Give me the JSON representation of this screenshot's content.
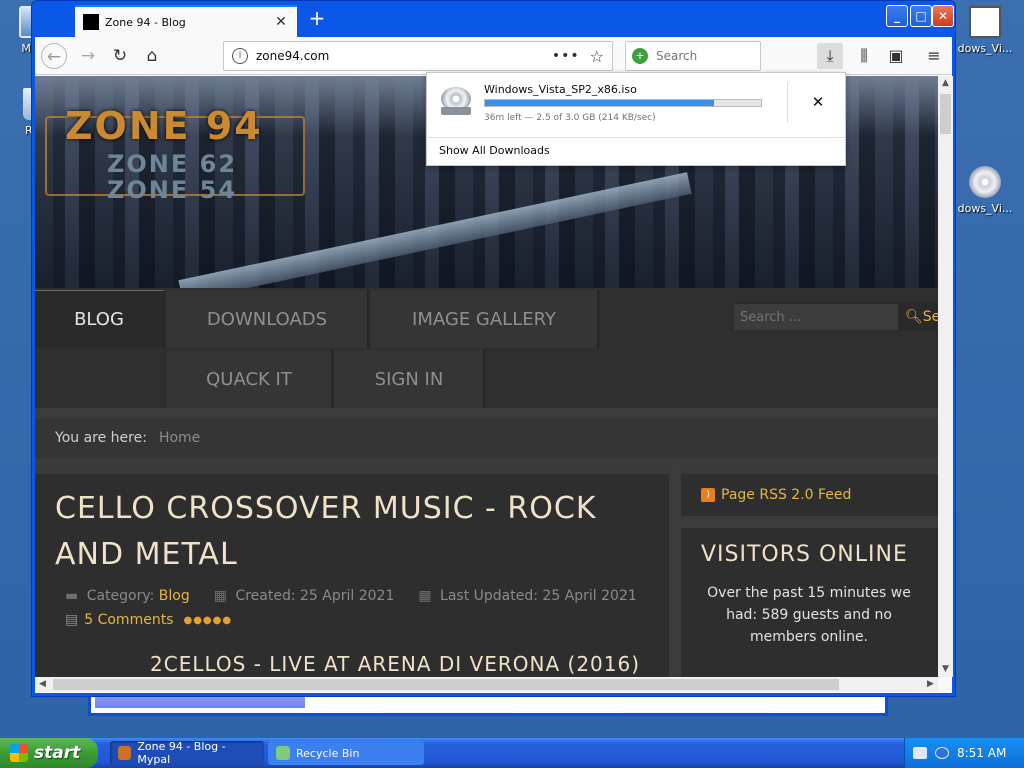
{
  "desktop": {
    "icons": [
      {
        "label": "My C"
      },
      {
        "label": "Rec"
      },
      {
        "label": "dows_Vi..."
      },
      {
        "label": "dows_Vi..."
      }
    ]
  },
  "browser": {
    "tab": {
      "title": "Zone 94 - Blog",
      "close": "✕"
    },
    "new_tab": "+",
    "window_controls": {
      "minimize": "_",
      "maximize": "□",
      "close": "✕"
    },
    "url": "zone94.com",
    "search_placeholder": "Search",
    "icons": [
      "back-icon",
      "forward-icon",
      "reload-icon",
      "home-icon",
      "info-icon",
      "more-icon",
      "star-icon",
      "download-icon",
      "library-icon",
      "sidebar-icon",
      "menu-icon"
    ]
  },
  "downloads": {
    "filename": "Windows_Vista_SP2_x86.iso",
    "status": "36m left — 2.5 of 3.0 GB (214 KB/sec)",
    "progress": 0.83,
    "show_all": "Show All Downloads"
  },
  "site": {
    "logo": {
      "main": "ZONE 94",
      "sub1": "ZONE 62",
      "sub2": "ZONE 54"
    },
    "menu": {
      "blog": "BLOG",
      "downloads": "DOWNLOADS",
      "image_gallery": "IMAGE GALLERY",
      "quack_it": "QUACK IT",
      "sign_in": "SIGN IN"
    },
    "search_placeholder": "Search ...",
    "search_button": "Se",
    "breadcrumb": {
      "label": "You are here:",
      "home": "Home"
    },
    "article": {
      "title": "CELLO CROSSOVER MUSIC - ROCK AND METAL",
      "category_label": "Category:",
      "category": "Blog",
      "created": "Created: 25 April 2021",
      "updated": "Last Updated: 25 April 2021",
      "comments": "5 Comments",
      "video_title": "2CELLOS - LIVE AT ARENA DI VERONA (2016)"
    },
    "rss": "Page RSS 2.0 Feed",
    "visitors": {
      "title": "VISITORS ONLINE",
      "text": "Over the past 15 minutes we had: 589 guests and no members online."
    }
  },
  "taskbar": {
    "start": "start",
    "tasks": [
      {
        "label": "Zone 94 - Blog - Mypal"
      },
      {
        "label": "Recycle Bin"
      }
    ],
    "clock": "8:51 AM"
  }
}
